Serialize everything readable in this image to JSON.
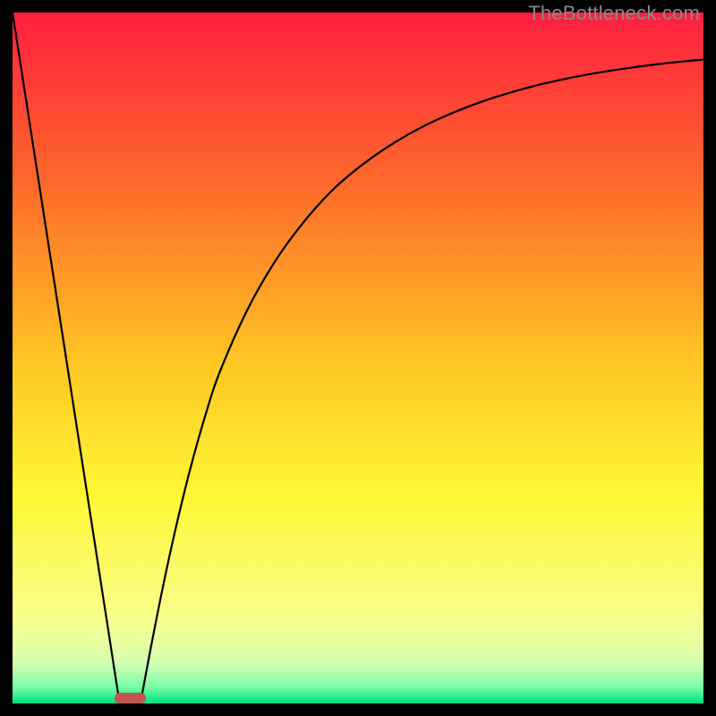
{
  "watermark": {
    "text": "TheBottleneck.com"
  },
  "chart_data": {
    "type": "line",
    "title": "",
    "xlabel": "",
    "ylabel": "",
    "xlim": [
      0,
      100
    ],
    "ylim": [
      0,
      100
    ],
    "grid": false,
    "legend": false,
    "background_gradient": {
      "stops": [
        {
          "pos": 0.0,
          "color": "#ff1f3f"
        },
        {
          "pos": 0.25,
          "color": "#ff6a2b"
        },
        {
          "pos": 0.5,
          "color": "#ffc424"
        },
        {
          "pos": 0.7,
          "color": "#fff835"
        },
        {
          "pos": 0.88,
          "color": "#f7ff8e"
        },
        {
          "pos": 0.94,
          "color": "#d7ffb0"
        },
        {
          "pos": 0.975,
          "color": "#7dffa8"
        },
        {
          "pos": 1.0,
          "color": "#00e07a"
        }
      ]
    },
    "series": [
      {
        "name": "left-line",
        "x": [
          0,
          15.5
        ],
        "y": [
          100,
          0
        ]
      },
      {
        "name": "right-curve",
        "x": [
          18.5,
          20,
          22,
          24,
          26,
          28,
          30,
          34,
          38,
          42,
          46,
          50,
          55,
          60,
          65,
          70,
          76,
          82,
          88,
          94,
          100
        ],
        "y": [
          0,
          8,
          18,
          27,
          35,
          42,
          48,
          57,
          64,
          69.5,
          74,
          77.5,
          81,
          83.8,
          86,
          87.8,
          89.5,
          90.8,
          91.8,
          92.6,
          93.2
        ]
      }
    ],
    "marker": {
      "x": 17,
      "width": 4.5,
      "height": 1.6,
      "color": "#c1554e"
    }
  }
}
